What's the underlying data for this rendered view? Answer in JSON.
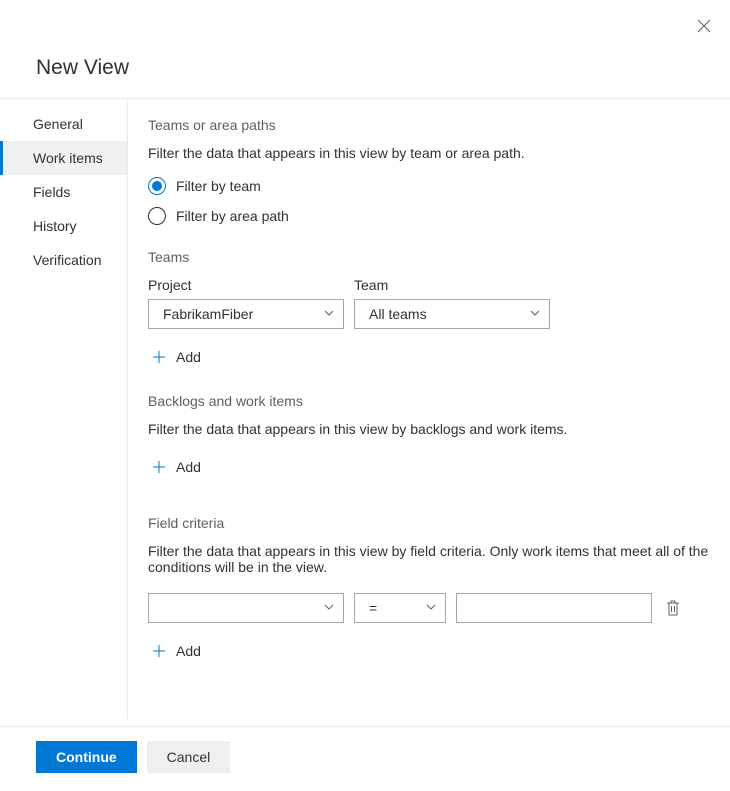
{
  "title": "New View",
  "sidebar": {
    "items": [
      {
        "label": "General",
        "selected": false
      },
      {
        "label": "Work items",
        "selected": true
      },
      {
        "label": "Fields",
        "selected": false
      },
      {
        "label": "History",
        "selected": false
      },
      {
        "label": "Verification",
        "selected": false
      }
    ]
  },
  "sections": {
    "teams_paths": {
      "title": "Teams or area paths",
      "desc": "Filter the data that appears in this view by team or area path.",
      "options": [
        {
          "label": "Filter by team",
          "selected": true
        },
        {
          "label": "Filter by area path",
          "selected": false
        }
      ]
    },
    "teams": {
      "title": "Teams",
      "project_label": "Project",
      "project_value": "FabrikamFiber",
      "team_label": "Team",
      "team_value": "All teams",
      "add_label": "Add"
    },
    "backlogs": {
      "title": "Backlogs and work items",
      "desc": "Filter the data that appears in this view by backlogs and work items.",
      "add_label": "Add"
    },
    "criteria": {
      "title": "Field criteria",
      "desc": "Filter the data that appears in this view by field criteria. Only work items that meet all of the conditions will be in the view.",
      "operator": "=",
      "add_label": "Add"
    }
  },
  "footer": {
    "continue": "Continue",
    "cancel": "Cancel"
  }
}
